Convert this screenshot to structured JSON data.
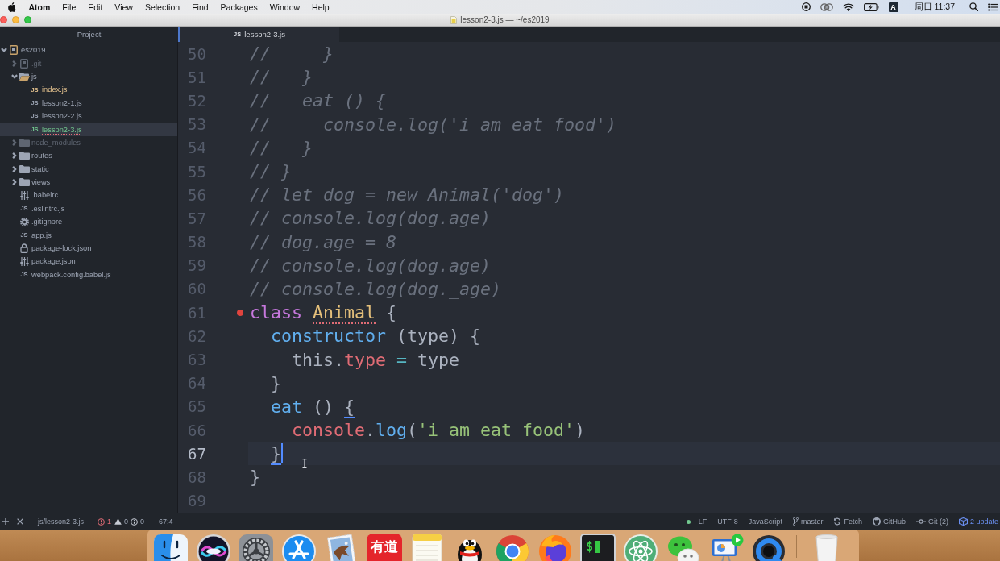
{
  "menu_bar": {
    "app_name": "Atom",
    "menus": [
      "File",
      "Edit",
      "View",
      "Selection",
      "Find",
      "Packages",
      "Window",
      "Help"
    ],
    "input_source": "A",
    "clock": "周日 11:37"
  },
  "window": {
    "title": "lesson2-3.js — ~/es2019"
  },
  "tab_bar": {
    "panel_tab": "Project",
    "tabs": [
      {
        "label": "lesson2-3.js",
        "icon_text": "JS",
        "selected": true
      }
    ]
  },
  "tree": {
    "items": [
      {
        "name": "es2019",
        "kind": "repo",
        "color": "#9da5b4",
        "error": false,
        "selected": false,
        "expanded": true,
        "children": [
          {
            "name": ".git",
            "kind": "repo",
            "color": "#5f6672",
            "error": false,
            "selected": false,
            "expanded": false
          },
          {
            "name": "js",
            "kind": "folder",
            "color": "#9da5b4",
            "error": false,
            "selected": false,
            "expanded": true,
            "children": [
              {
                "name": "index.js",
                "kind": "script",
                "icon_text": "JS",
                "color": "#e2c08d",
                "error": false,
                "selected": false
              },
              {
                "name": "lesson2-1.js",
                "kind": "script",
                "icon_text": "JS",
                "color": "#9da5b4",
                "error": false,
                "selected": false
              },
              {
                "name": "lesson2-2.js",
                "kind": "script",
                "icon_text": "JS",
                "color": "#9da5b4",
                "error": false,
                "selected": false
              },
              {
                "name": "lesson2-3.js",
                "kind": "script",
                "icon_text": "JS",
                "color": "#73c990",
                "error": true,
                "selected": true
              }
            ]
          },
          {
            "name": "node_modules",
            "kind": "folder",
            "color": "#5f6672",
            "error": false,
            "selected": false,
            "expanded": false
          },
          {
            "name": "routes",
            "kind": "folder",
            "color": "#9da5b4",
            "error": false,
            "selected": false,
            "expanded": false
          },
          {
            "name": "static",
            "kind": "folder",
            "color": "#9da5b4",
            "error": false,
            "selected": false,
            "expanded": false
          },
          {
            "name": "views",
            "kind": "folder",
            "color": "#9da5b4",
            "error": false,
            "selected": false,
            "expanded": false
          },
          {
            "name": ".babelrc",
            "kind": "config",
            "color": "#9da5b4",
            "error": false,
            "selected": false
          },
          {
            "name": ".eslintrc.js",
            "kind": "script",
            "icon_text": "JS",
            "color": "#9da5b4",
            "error": false,
            "selected": false
          },
          {
            "name": ".gitignore",
            "kind": "ignore",
            "color": "#9da5b4",
            "error": false,
            "selected": false
          },
          {
            "name": "app.js",
            "kind": "script",
            "icon_text": "JS",
            "color": "#9da5b4",
            "error": false,
            "selected": false
          },
          {
            "name": "package-lock.json",
            "kind": "lock",
            "color": "#9da5b4",
            "error": false,
            "selected": false
          },
          {
            "name": "package.json",
            "kind": "config",
            "color": "#9da5b4",
            "error": false,
            "selected": false
          },
          {
            "name": "webpack.config.babel.js",
            "kind": "script",
            "icon_text": "JS",
            "color": "#9da5b4",
            "error": false,
            "selected": false
          }
        ]
      }
    ]
  },
  "editor": {
    "lines": [
      {
        "number": "50",
        "error": false,
        "cursor": false,
        "tokens": [
          {
            "kind": "comment",
            "text": "//     }"
          }
        ]
      },
      {
        "number": "51",
        "error": false,
        "cursor": false,
        "tokens": [
          {
            "kind": "comment",
            "text": "//   }"
          }
        ]
      },
      {
        "number": "52",
        "error": false,
        "cursor": false,
        "tokens": [
          {
            "kind": "comment",
            "text": "//   eat () {"
          }
        ]
      },
      {
        "number": "53",
        "error": false,
        "cursor": false,
        "tokens": [
          {
            "kind": "comment",
            "text": "//     console.log('i am eat food')"
          }
        ]
      },
      {
        "number": "54",
        "error": false,
        "cursor": false,
        "tokens": [
          {
            "kind": "comment",
            "text": "//   }"
          }
        ]
      },
      {
        "number": "55",
        "error": false,
        "cursor": false,
        "tokens": [
          {
            "kind": "comment",
            "text": "// }"
          }
        ]
      },
      {
        "number": "56",
        "error": false,
        "cursor": false,
        "tokens": [
          {
            "kind": "comment",
            "text": "// let dog = new Animal('dog')"
          }
        ]
      },
      {
        "number": "57",
        "error": false,
        "cursor": false,
        "tokens": [
          {
            "kind": "comment",
            "text": "// console.log(dog.age)"
          }
        ]
      },
      {
        "number": "58",
        "error": false,
        "cursor": false,
        "tokens": [
          {
            "kind": "comment",
            "text": "// dog.age = 8"
          }
        ]
      },
      {
        "number": "59",
        "error": false,
        "cursor": false,
        "tokens": [
          {
            "kind": "comment",
            "text": "// console.log(dog.age)"
          }
        ]
      },
      {
        "number": "60",
        "error": false,
        "cursor": false,
        "tokens": [
          {
            "kind": "comment",
            "text": "// console.log(dog._age)"
          }
        ]
      },
      {
        "number": "61",
        "error": true,
        "cursor": false,
        "tokens": [
          {
            "kind": "keyword",
            "text": "class "
          },
          {
            "kind": "class-error",
            "text": "Animal"
          },
          {
            "kind": "plain",
            "text": " {"
          }
        ]
      },
      {
        "number": "62",
        "error": false,
        "cursor": false,
        "tokens": [
          {
            "kind": "function",
            "text": "  constructor"
          },
          {
            "kind": "plain",
            "text": " (type) {"
          }
        ]
      },
      {
        "number": "63",
        "error": false,
        "cursor": false,
        "tokens": [
          {
            "kind": "plain",
            "text": "    this."
          },
          {
            "kind": "property",
            "text": "type"
          },
          {
            "kind": "operator",
            "text": " ="
          },
          {
            "kind": "plain",
            "text": " type"
          }
        ]
      },
      {
        "number": "64",
        "error": false,
        "cursor": false,
        "tokens": [
          {
            "kind": "plain",
            "text": "  }"
          }
        ]
      },
      {
        "number": "65",
        "error": false,
        "cursor": false,
        "tokens": [
          {
            "kind": "function",
            "text": "  eat"
          },
          {
            "kind": "plain",
            "text": " () "
          },
          {
            "kind": "bracket-match",
            "text": "{"
          }
        ]
      },
      {
        "number": "66",
        "error": false,
        "cursor": false,
        "tokens": [
          {
            "kind": "variable",
            "text": "    console"
          },
          {
            "kind": "plain",
            "text": "."
          },
          {
            "kind": "function",
            "text": "log"
          },
          {
            "kind": "plain",
            "text": "("
          },
          {
            "kind": "string",
            "text": "'i am eat food'"
          },
          {
            "kind": "plain",
            "text": ")"
          }
        ]
      },
      {
        "number": "67",
        "error": false,
        "cursor": true,
        "tokens": [
          {
            "kind": "bracket-match",
            "text": "  }"
          }
        ]
      },
      {
        "number": "68",
        "error": false,
        "cursor": false,
        "tokens": [
          {
            "kind": "plain",
            "text": "}"
          }
        ]
      },
      {
        "number": "69",
        "error": false,
        "cursor": false
      }
    ]
  },
  "status_bar": {
    "file_path": "js/lesson2-3.js",
    "errors": "1",
    "warnings": "0",
    "infos": "0",
    "cursor_position": "67:4",
    "line_ending": "LF",
    "encoding": "UTF-8",
    "grammar": "JavaScript",
    "branch": "master",
    "fetch": "Fetch",
    "github": "GitHub",
    "git": "Git (2)",
    "updates": "2 update"
  },
  "dock": {
    "icon_texts": [
      "有道",
      "$"
    ]
  }
}
